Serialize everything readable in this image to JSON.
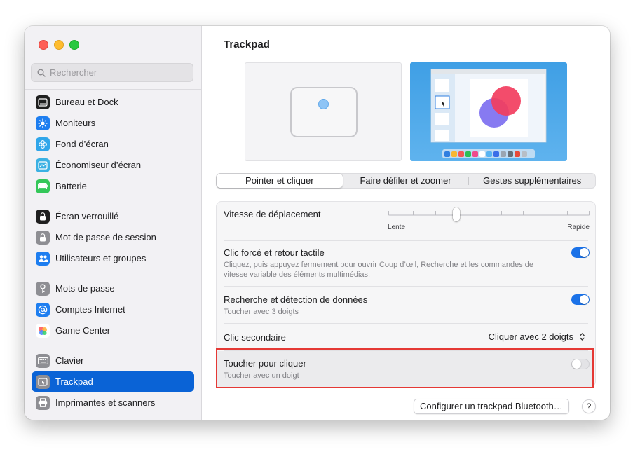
{
  "search": {
    "placeholder": "Rechercher"
  },
  "sidebar": {
    "items": [
      {
        "label": "Bureau et Dock",
        "icon": "dock-icon",
        "color": "#1f1f1f"
      },
      {
        "label": "Moniteurs",
        "icon": "display-brightness-icon",
        "color": "#1e7ef0"
      },
      {
        "label": "Fond d’écran",
        "icon": "wallpaper-flower-icon",
        "color": "#30a6ea"
      },
      {
        "label": "Économiseur d’écran",
        "icon": "screensaver-icon",
        "color": "#3bb1e3"
      },
      {
        "label": "Batterie",
        "icon": "battery-icon",
        "color": "#34c759"
      },
      {
        "label": "Écran verrouillé",
        "icon": "lock-screen-icon",
        "color": "#1f1f1f"
      },
      {
        "label": "Mot de passe de session",
        "icon": "padlock-icon",
        "color": "#8e8e93"
      },
      {
        "label": "Utilisateurs et groupes",
        "icon": "users-group-icon",
        "color": "#1e7ef0"
      },
      {
        "label": "Mots de passe",
        "icon": "key-icon",
        "color": "#8e8e93"
      },
      {
        "label": "Comptes Internet",
        "icon": "at-sign-icon",
        "color": "#1e7ef0"
      },
      {
        "label": "Game Center",
        "icon": "game-center-icon",
        "color": "#ffffff"
      },
      {
        "label": "Clavier",
        "icon": "keyboard-icon",
        "color": "#8e8e93"
      },
      {
        "label": "Trackpad",
        "icon": "trackpad-icon",
        "color": "#8e8e93",
        "selected": true
      },
      {
        "label": "Imprimantes et scanners",
        "icon": "printer-icon",
        "color": "#8e8e93"
      }
    ]
  },
  "main": {
    "title": "Trackpad",
    "tabs": [
      {
        "label": "Pointer et cliquer",
        "active": true
      },
      {
        "label": "Faire défiler et zoomer",
        "active": false
      },
      {
        "label": "Gestes supplémentaires",
        "active": false
      }
    ],
    "settings": {
      "speed": {
        "title": "Vitesse de déplacement",
        "min_label": "Lente",
        "max_label": "Rapide",
        "value_fraction": 0.33
      },
      "force_click": {
        "title": "Clic forcé et retour tactile",
        "subtitle": "Cliquez, puis appuyez fermement pour ouvrir Coup d’œil, Recherche et les commandes de vitesse variable des éléments multimédias.",
        "enabled": true
      },
      "lookup": {
        "title": "Recherche et détection de données",
        "subtitle": "Toucher avec 3 doigts",
        "enabled": true
      },
      "secondary_click": {
        "title": "Clic secondaire",
        "value": "Cliquer avec 2 doigts"
      },
      "tap_to_click": {
        "title": "Toucher pour cliquer",
        "subtitle": "Toucher avec un doigt",
        "enabled": false
      }
    },
    "buttons": {
      "configure": "Configurer un trackpad Bluetooth…",
      "help": "?"
    }
  },
  "colors": {
    "accent": "#0a63d6",
    "highlight": "#e53935"
  }
}
